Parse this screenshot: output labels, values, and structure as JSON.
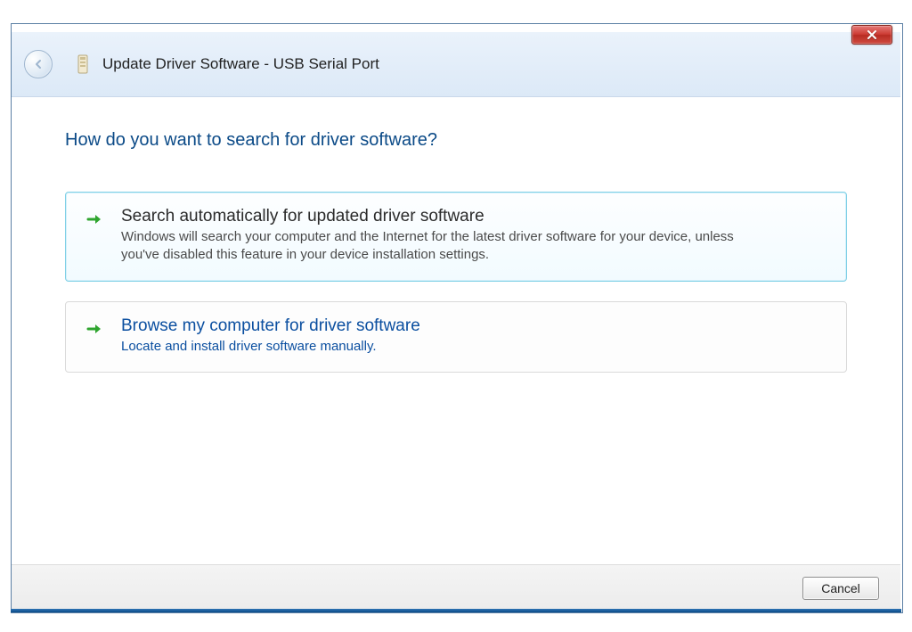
{
  "window": {
    "title": "Update Driver Software - USB Serial Port"
  },
  "heading": "How do you want to search for driver software?",
  "options": [
    {
      "title": "Search automatically for updated driver software",
      "description": "Windows will search your computer and the Internet for the latest driver software for your device, unless you've disabled this feature in your device installation settings."
    },
    {
      "title": "Browse my computer for driver software",
      "description": "Locate and install driver software manually."
    }
  ],
  "buttons": {
    "cancel": "Cancel"
  }
}
